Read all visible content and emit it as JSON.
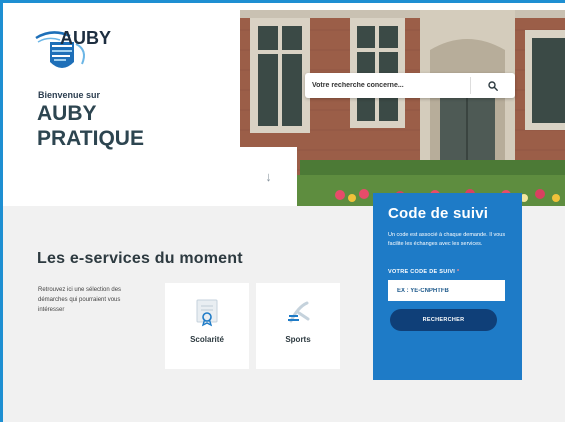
{
  "brand": {
    "name": "AUBY"
  },
  "header": {
    "welcome": "Bienvenue sur",
    "title_line1": "AUBY",
    "title_line2": "PRATIQUE"
  },
  "search": {
    "placeholder": "Votre recherche concerne..."
  },
  "scroll": {
    "arrow": "↓"
  },
  "services": {
    "title": "Les e-services du moment",
    "description": "Retrouvez ici une sélection des démarches qui pourraient vous intéresser",
    "cards": [
      {
        "label": "Scolarité",
        "icon": "certificate-icon"
      },
      {
        "label": "Sports",
        "icon": "sports-icon"
      }
    ]
  },
  "tracking": {
    "title": "Code de suivi",
    "text": "Un code est associé à chaque demande. Il vous facilite les échanges avec les services.",
    "label": "VOTRE CODE DE SUIVI",
    "required_mark": "*",
    "placeholder": "EX : YE-CNPHTFB",
    "button": "RECHERCHER"
  },
  "colors": {
    "accent": "#1e7bc7",
    "button_dark": "#0f3f78",
    "frame": "#1e8fd2",
    "section_bg": "#f1f1f1"
  }
}
